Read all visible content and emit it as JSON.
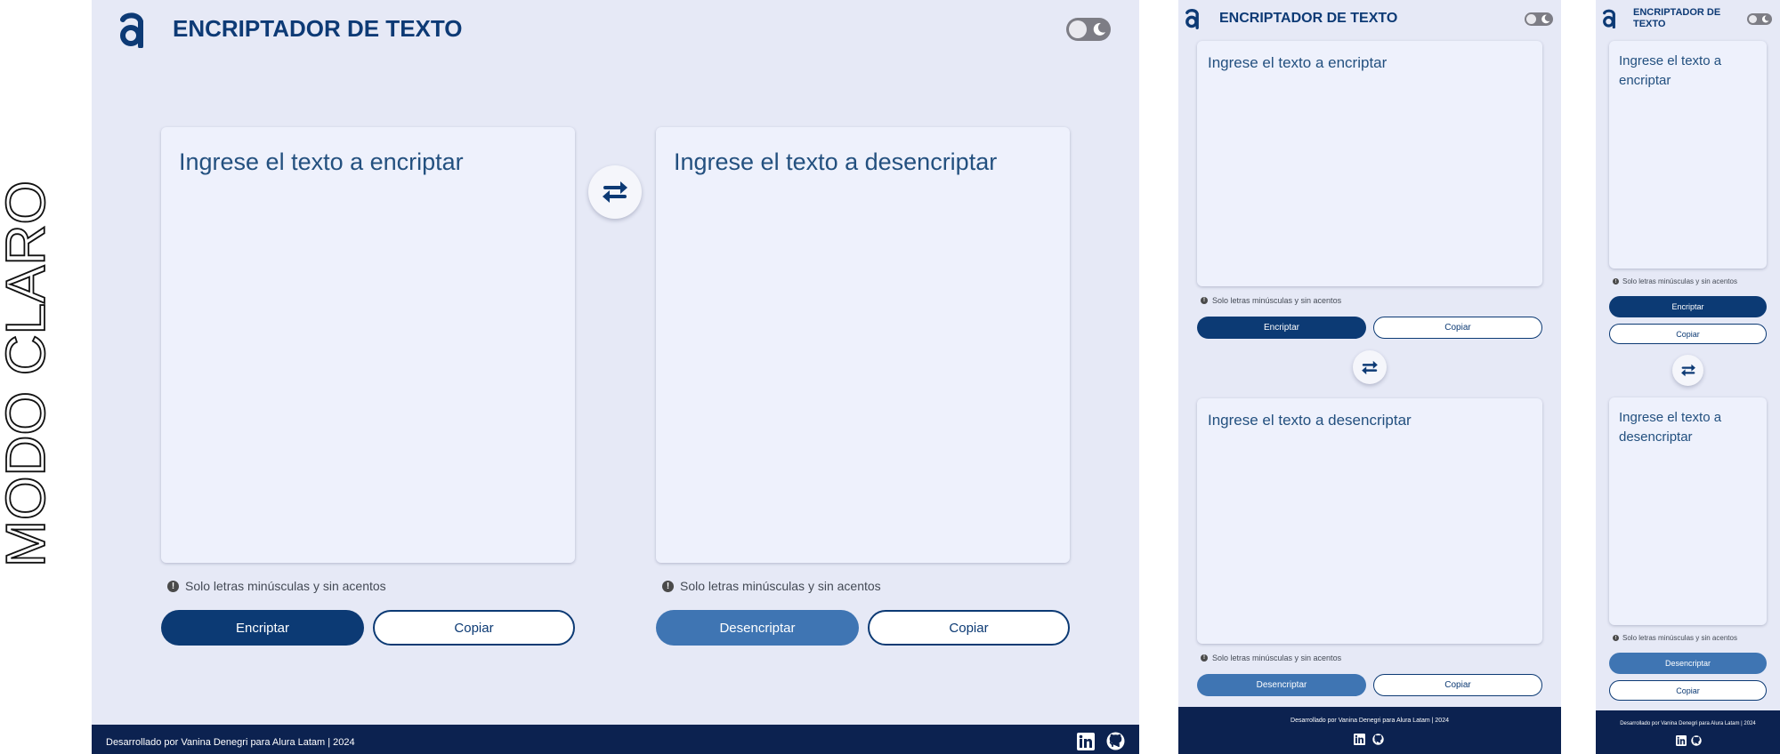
{
  "side_label": "MODO CLARO",
  "colors": {
    "background": "#e6e9f6",
    "card": "#eef1fc",
    "primary": "#0c3a74",
    "secondary": "#3f75b3",
    "footer": "#0c2250",
    "toggle": "#7d7d85"
  },
  "header": {
    "title": "ENCRIPTADOR DE TEXTO",
    "logo_icon": "alura-a-logo-icon",
    "toggle_icon": "moon-icon",
    "theme_toggle_on": false
  },
  "encrypt_panel": {
    "placeholder": "Ingrese el texto a encriptar",
    "placeholder_value": "",
    "hint": "Solo letras minúsculas y sin acentos",
    "hint_icon": "info-icon",
    "action_label": "Encriptar",
    "copy_label": "Copiar"
  },
  "decrypt_panel": {
    "placeholder": "Ingrese el texto a desencriptar",
    "placeholder_value": "",
    "hint": "Solo letras minúsculas y sin acentos",
    "hint_icon": "info-icon",
    "action_label": "Desencriptar",
    "copy_label": "Copiar"
  },
  "swap_icon": "swap-arrows-icon",
  "footer": {
    "credit": "Desarrollado por Vanina Denegri para Alura Latam | 2024",
    "social_icons": [
      "linkedin-icon",
      "github-icon"
    ]
  }
}
